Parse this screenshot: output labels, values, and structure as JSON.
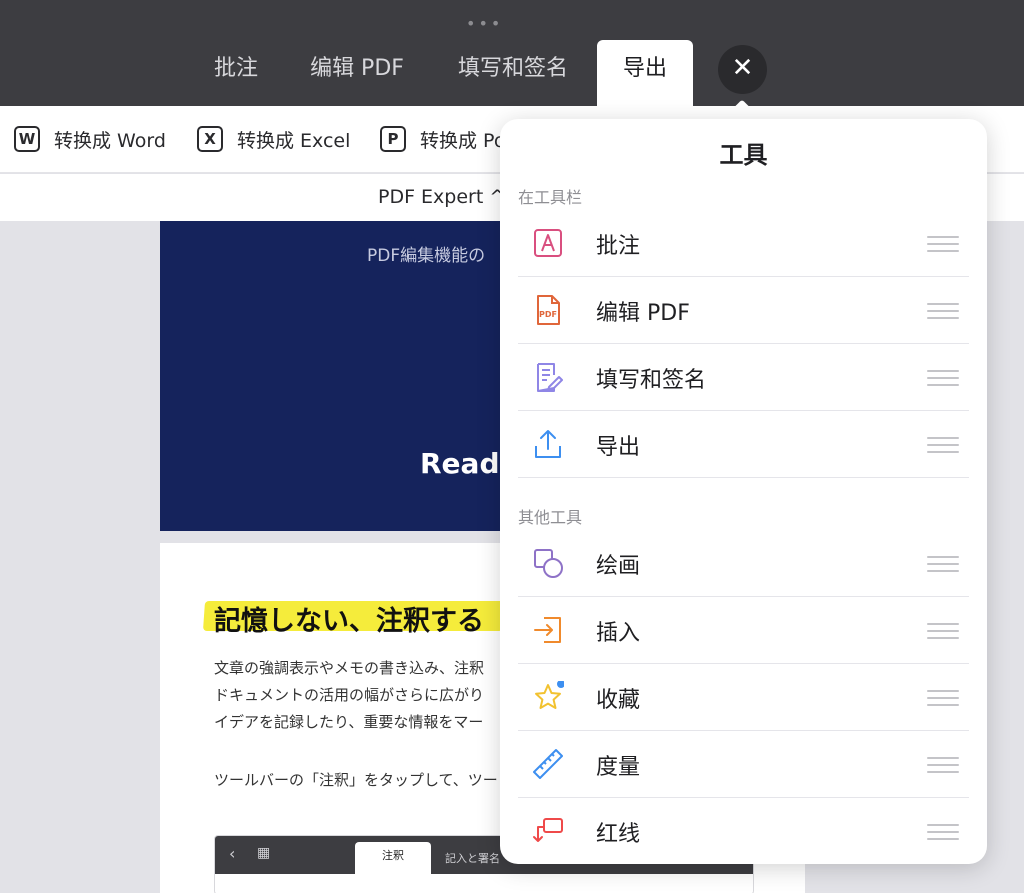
{
  "header": {
    "grabber": "•••",
    "tabs": [
      {
        "label": "批注",
        "active": false
      },
      {
        "label": "编辑 PDF",
        "active": false
      },
      {
        "label": "填写和签名",
        "active": false
      },
      {
        "label": "导出",
        "active": true
      }
    ],
    "close_label": "✕"
  },
  "toolbar": {
    "items": [
      {
        "icon": "W",
        "label": "转换成 Word"
      },
      {
        "icon": "X",
        "label": "转换成 Excel"
      },
      {
        "icon": "P",
        "label": "转换成 Po"
      }
    ]
  },
  "subheader": {
    "label": "PDF Expert ^"
  },
  "document": {
    "page1_caption": "PDF編集機能の",
    "page1_ready": "Read",
    "page2_heading": "記憶しない、注釈する",
    "page2_lines": [
      "文章の強調表示やメモの書き込み、注釈",
      "ドキュメントの活用の幅がさらに広がり",
      "イデアを記録したり、重要な情報をマー",
      "ツールバーの「注釈」をタップして、ツー"
    ],
    "mini_toolbar": {
      "back": "‹",
      "grid": "▦",
      "active_tab": "注釈",
      "tab": "記入と署名"
    }
  },
  "popover": {
    "title": "工具",
    "section_toolbar": "在工具栏",
    "section_other": "其他工具",
    "toolbar_items": [
      {
        "icon": "annotate-icon",
        "label": "批注"
      },
      {
        "icon": "pdf-file-icon",
        "label": "编辑 PDF"
      },
      {
        "icon": "fill-sign-icon",
        "label": "填写和签名"
      },
      {
        "icon": "share-upload-icon",
        "label": "导出"
      }
    ],
    "other_items": [
      {
        "icon": "shapes-icon",
        "label": "绘画"
      },
      {
        "icon": "insert-icon",
        "label": "插入"
      },
      {
        "icon": "star-icon",
        "label": "收藏"
      },
      {
        "icon": "ruler-icon",
        "label": "度量"
      },
      {
        "icon": "redline-icon",
        "label": "红线"
      }
    ],
    "colors": {
      "annotate": "#d94f7f",
      "pdf": "#e0663a",
      "fill": "#8f86e6",
      "export": "#3d8ff0",
      "shapes": "#8e72c7",
      "insert": "#f08a2c",
      "star": "#f2c230",
      "star_dot": "#3d8ff0",
      "ruler": "#3d8ff0",
      "redline": "#ef4a4a"
    }
  }
}
